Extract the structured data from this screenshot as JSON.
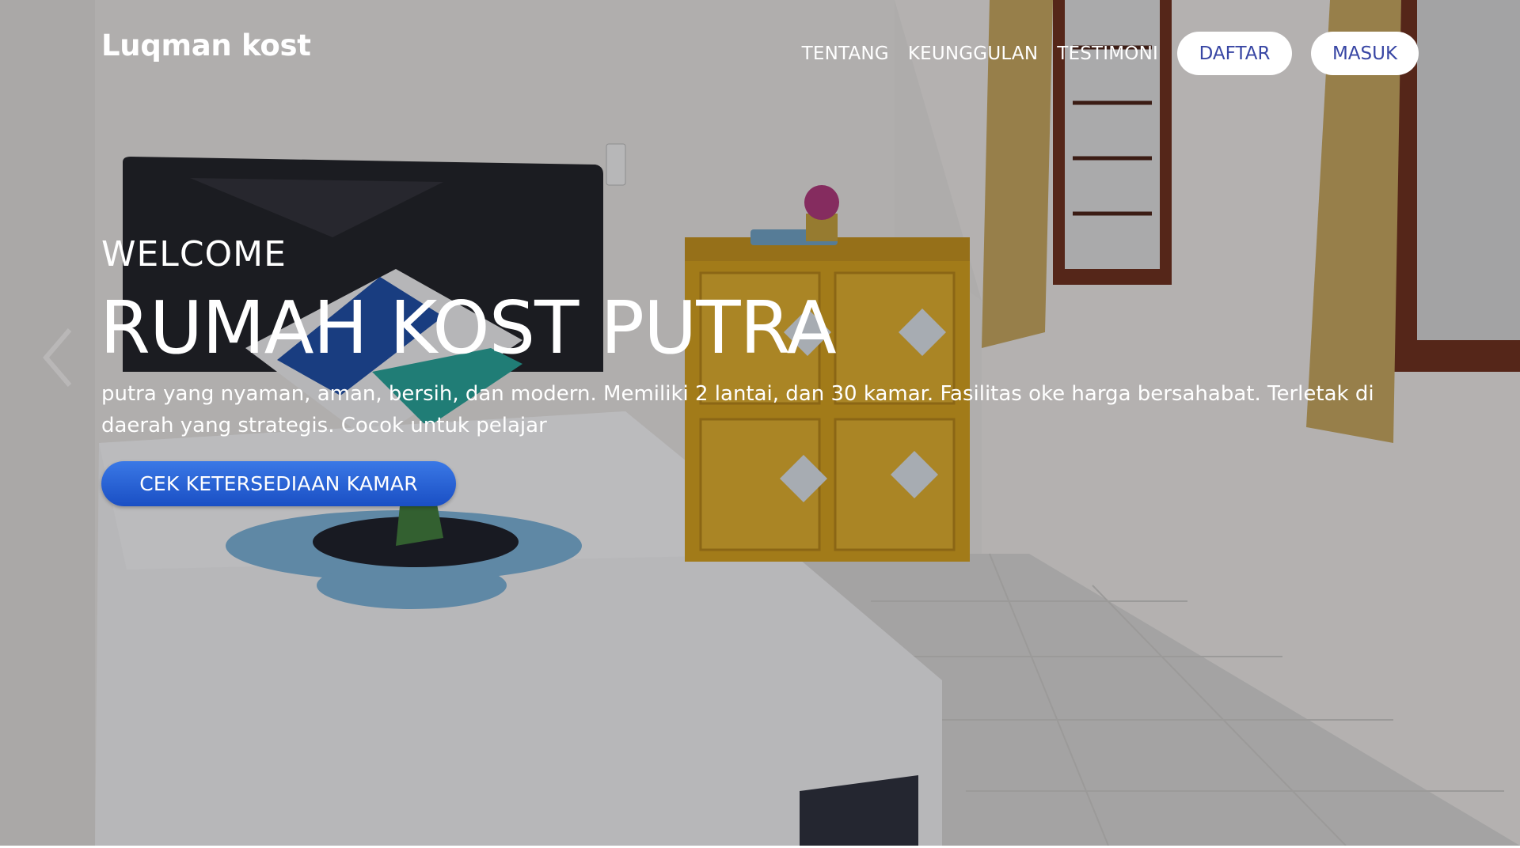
{
  "brand": "Luqman kost",
  "nav": {
    "links": [
      "TENTANG",
      "KEUNGGULAN",
      "TESTIMONI"
    ],
    "register_label": "DAFTAR",
    "login_label": "MASUK"
  },
  "hero": {
    "eyebrow": "WELCOME",
    "title": "RUMAH KOST PUTRA",
    "description": "putra yang nyaman, aman, bersih, dan modern. Memiliki 2 lantai, dan 30 kamar. Fasilitas oke harga bersahabat. Terletak di daerah yang strategis. Cocok untuk pelajar",
    "cta_label": "CEK KETERSEDIAAN KAMAR",
    "background_image": "room-photo",
    "carousel_prev_icon": "chevron-left-icon"
  },
  "colors": {
    "button_text": "#3846a4",
    "cta_gradient_top": "#3a78e6",
    "cta_gradient_bottom": "#1a4fc4"
  }
}
